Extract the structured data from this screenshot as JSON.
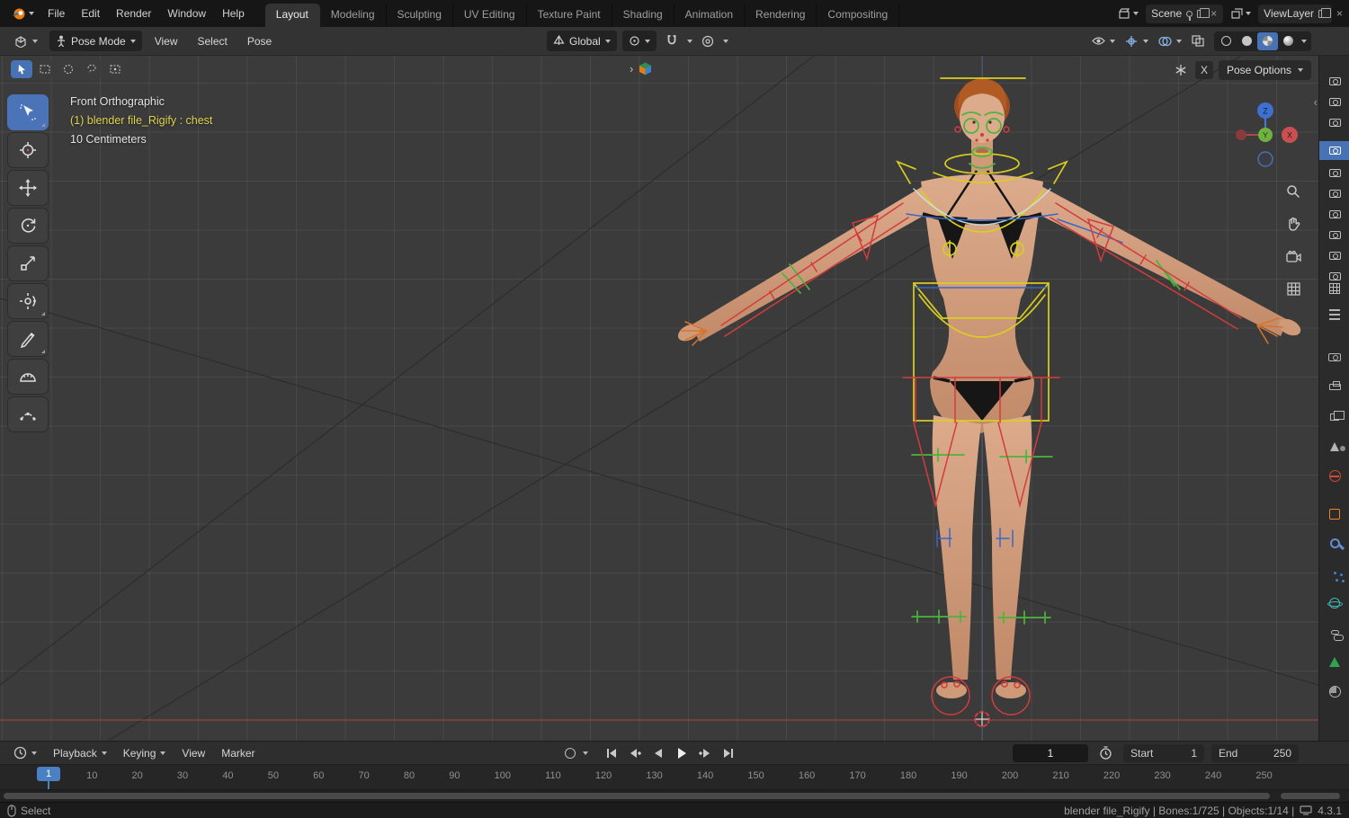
{
  "topbar": {
    "menus": [
      "File",
      "Edit",
      "Render",
      "Window",
      "Help"
    ],
    "tabs": [
      "Layout",
      "Modeling",
      "Sculpting",
      "UV Editing",
      "Texture Paint",
      "Shading",
      "Animation",
      "Rendering",
      "Compositing"
    ],
    "active_tab": "Layout",
    "scene_label": "Scene",
    "viewlayer_label": "ViewLayer"
  },
  "viewport_header": {
    "mode_label": "Pose Mode",
    "menus": [
      "View",
      "Select",
      "Pose"
    ],
    "orientation_label": "Global"
  },
  "viewport": {
    "view_label": "Front Orthographic",
    "active_object": "(1) blender file_Rigify : chest",
    "scale_label": "10 Centimeters",
    "pose_options_label": "Pose Options",
    "clear_label": "X"
  },
  "timeline": {
    "menus": [
      "Playback",
      "Keying",
      "View",
      "Marker"
    ],
    "current_frame": "1",
    "playhead_label": "1",
    "start_label": "Start",
    "start_value": "1",
    "end_label": "End",
    "end_value": "250",
    "ticks": [
      "1",
      "10",
      "20",
      "30",
      "40",
      "50",
      "60",
      "70",
      "80",
      "90",
      "100",
      "110",
      "120",
      "130",
      "140",
      "150",
      "160",
      "170",
      "180",
      "190",
      "200",
      "210",
      "220",
      "230",
      "240",
      "250"
    ]
  },
  "statusbar": {
    "left_label": "Select",
    "stats": "blender file_Rigify | Bones:1/725 | Objects:1/14 |",
    "version": "4.3.1"
  },
  "icons": {
    "left_tools": [
      "select-box-tool",
      "cursor-tool",
      "move-tool",
      "rotate-tool",
      "scale-tool",
      "transform-tool",
      "annotate-tool",
      "measure-tool",
      "breakdowner-tool"
    ],
    "properties_tabs": [
      "tool",
      "render",
      "output",
      "view-layer",
      "scene",
      "world",
      "object",
      "modifiers",
      "particles",
      "physics",
      "constraints",
      "object-data",
      "material"
    ],
    "colors": {
      "accent_blue": "#4772b3",
      "warning_yellow": "#ddd34f",
      "axis_red": "#d23c3c",
      "axis_green": "#49b53c",
      "axis_blue": "#3a66c8"
    }
  }
}
